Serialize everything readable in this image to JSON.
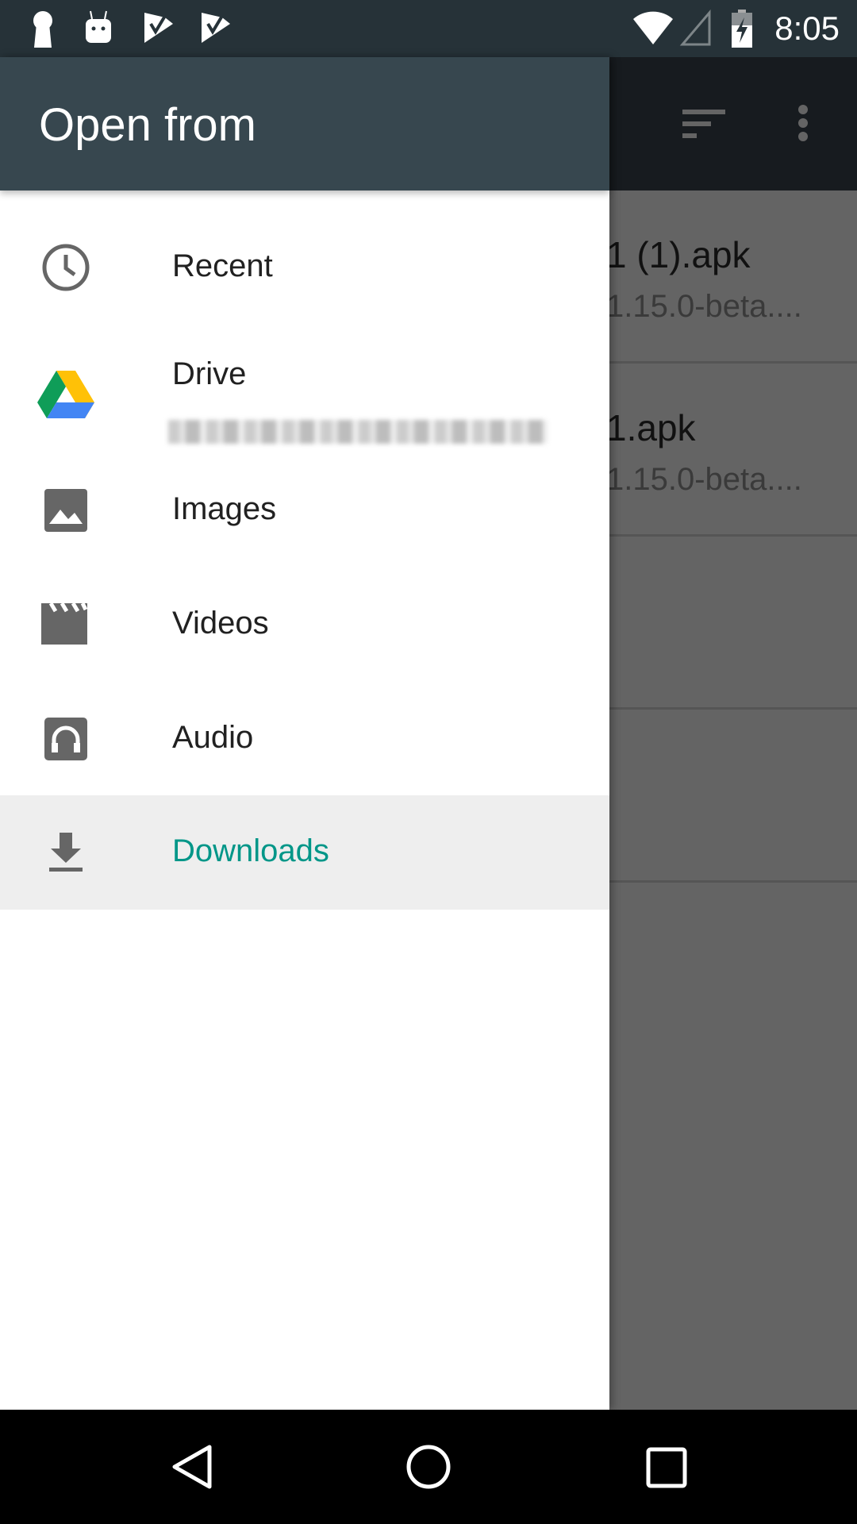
{
  "status_bar": {
    "time": "8:05",
    "left_icons": [
      "keyhole-icon",
      "android-icon",
      "task-check-icon",
      "task-check-icon"
    ],
    "right_icons": [
      "wifi-icon",
      "cell-signal-icon",
      "battery-charging-icon"
    ]
  },
  "drawer": {
    "title": "Open from",
    "items": [
      {
        "label": "Recent",
        "icon": "clock-icon"
      },
      {
        "label": "Drive",
        "icon": "google-drive-icon",
        "subtitle_redacted": true
      },
      {
        "label": "Images",
        "icon": "image-icon"
      },
      {
        "label": "Videos",
        "icon": "video-clapper-icon"
      },
      {
        "label": "Audio",
        "icon": "audio-headphones-icon"
      },
      {
        "label": "Downloads",
        "icon": "download-icon",
        "selected": true
      }
    ],
    "accent_color": "#009688"
  },
  "background": {
    "toolbar_icons": [
      "sort-icon",
      "more-vert-icon"
    ],
    "files": [
      {
        "name": "1 (1).apk",
        "subtitle": "1.15.0-beta...."
      },
      {
        "name": "1.apk",
        "subtitle": "1.15.0-beta...."
      }
    ]
  },
  "nav_bar": {
    "buttons": [
      "back",
      "home",
      "recents"
    ]
  }
}
